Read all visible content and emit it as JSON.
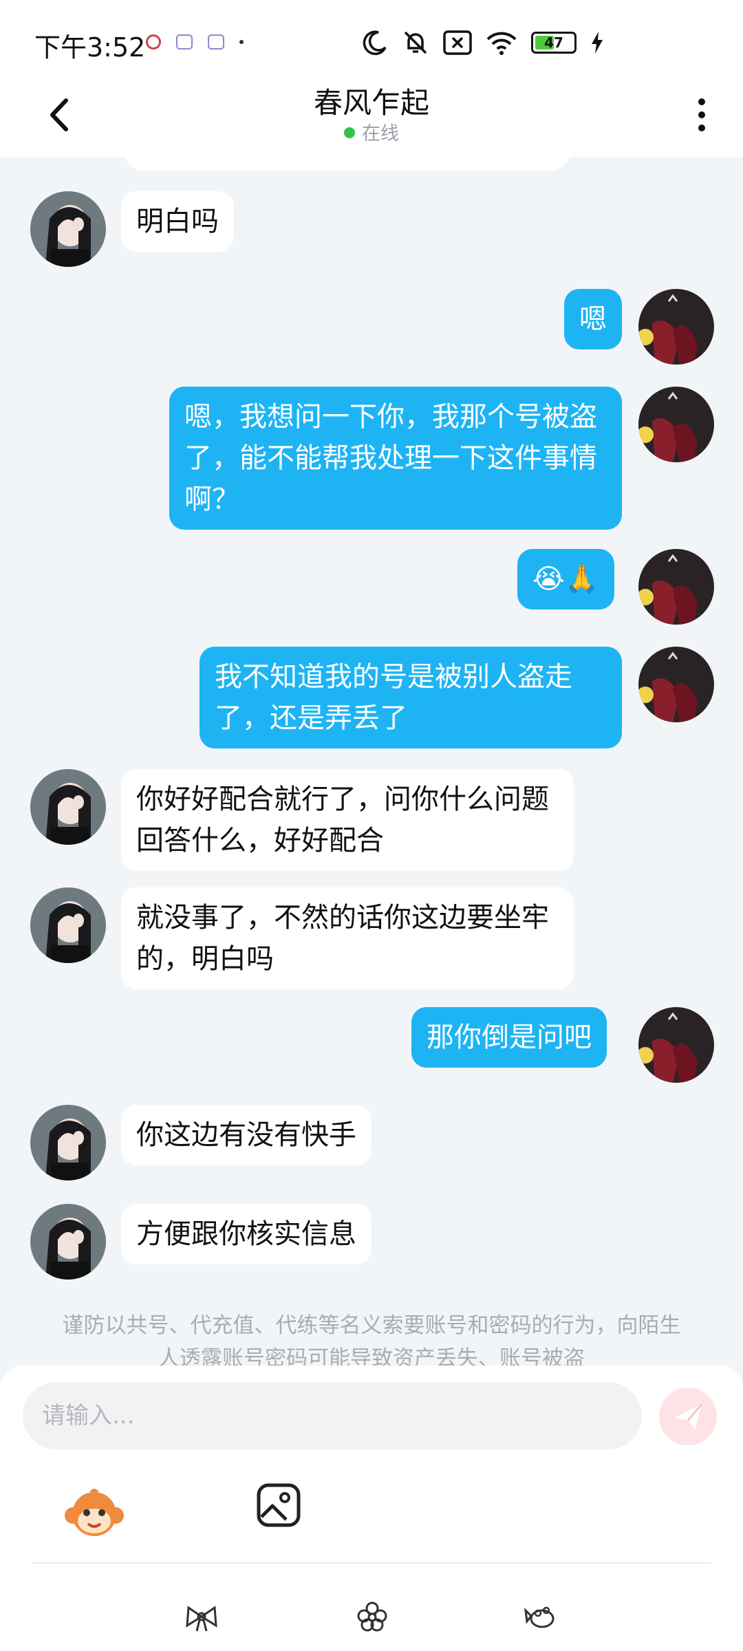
{
  "status_bar": {
    "time": "下午3:52",
    "battery": "47"
  },
  "header": {
    "title": "春风乍起",
    "status": "在线"
  },
  "messages": [
    {
      "side": "in",
      "text": "明白吗"
    },
    {
      "side": "out",
      "text": "嗯"
    },
    {
      "side": "out",
      "text": "嗯，我想问一下你，我那个号被盗了，能不能帮我处理一下这件事情啊？"
    },
    {
      "side": "out",
      "text": "😭🙏"
    },
    {
      "side": "out",
      "text": "我不知道我的号是被别人盗走了，还是弄丢了"
    },
    {
      "side": "in",
      "text": "你好好配合就行了，问你什么问题回答什么，好好配合"
    },
    {
      "side": "in",
      "text": "就没事了，不然的话你这边要坐牢的，明白吗"
    },
    {
      "side": "out",
      "text": "那你倒是问吧"
    },
    {
      "side": "in",
      "text": "你这边有没有快手"
    },
    {
      "side": "in",
      "text": "方便跟你核实信息"
    }
  ],
  "notice": "谨防以共号、代充值、代练等名义索要账号和密码的行为，向陌生人透露账号密码可能导致资产丢失、账号被盗",
  "input": {
    "placeholder": "请输入..."
  },
  "colors": {
    "outgoing_bubble": "#1eb4f4",
    "background": "#f2f5f8",
    "online_dot": "#33c24d"
  }
}
